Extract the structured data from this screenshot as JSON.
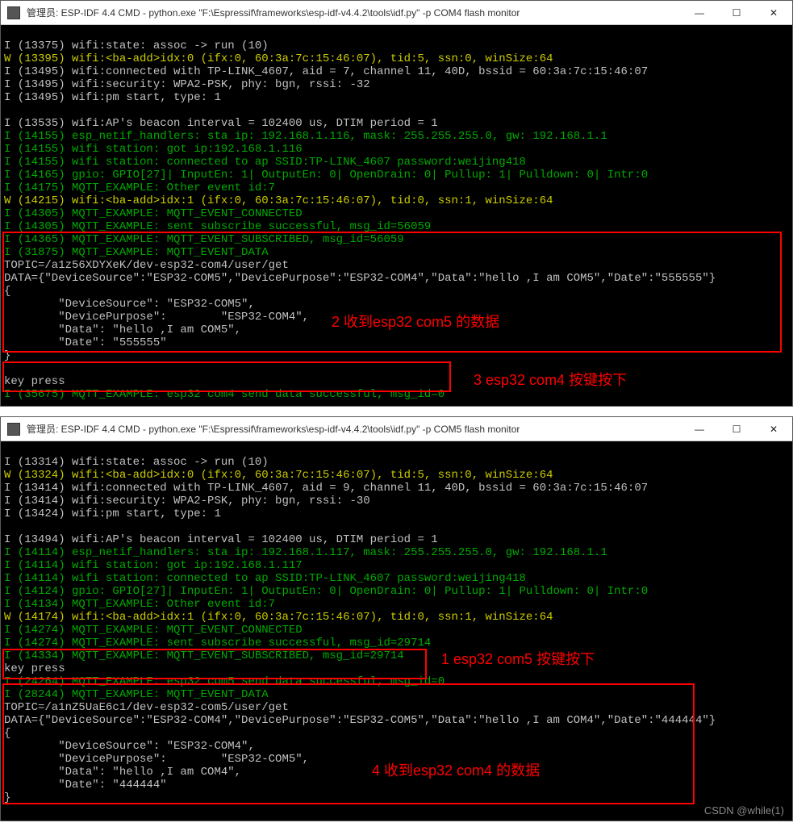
{
  "top": {
    "title": "管理员: ESP-IDF 4.4 CMD - python.exe  \"F:\\Espressif\\frameworks\\esp-idf-v4.4.2\\tools\\idf.py\" -p COM4 flash monitor",
    "lines": {
      "l01": "I (13375) wifi:state: assoc -> run (10)",
      "l02": "W (13395) wifi:<ba-add>idx:0 (ifx:0, 60:3a:7c:15:46:07), tid:5, ssn:0, winSize:64",
      "l03": "I (13495) wifi:connected with TP-LINK_4607, aid = 7, channel 11, 40D, bssid = 60:3a:7c:15:46:07",
      "l04": "I (13495) wifi:security: WPA2-PSK, phy: bgn, rssi: -32",
      "l05": "I (13495) wifi:pm start, type: 1",
      "l06": "",
      "l07": "I (13535) wifi:AP's beacon interval = 102400 us, DTIM period = 1",
      "l08": "I (14155) esp_netif_handlers: sta ip: 192.168.1.116, mask: 255.255.255.0, gw: 192.168.1.1",
      "l09": "I (14155) wifi station: got ip:192.168.1.116",
      "l10": "I (14155) wifi station: connected to ap SSID:TP-LINK_4607 password:weijing418",
      "l11": "I (14165) gpio: GPIO[27]| InputEn: 1| OutputEn: 0| OpenDrain: 0| Pullup: 1| Pulldown: 0| Intr:0",
      "l12": "I (14175) MQTT_EXAMPLE: Other event id:7",
      "l13": "W (14215) wifi:<ba-add>idx:1 (ifx:0, 60:3a:7c:15:46:07), tid:0, ssn:1, winSize:64",
      "l14": "I (14305) MQTT_EXAMPLE: MQTT_EVENT_CONNECTED",
      "l15": "I (14305) MQTT_EXAMPLE: sent subscribe successful, msg_id=56059",
      "l16": "I (14365) MQTT_EXAMPLE: MQTT_EVENT_SUBSCRIBED, msg_id=56059",
      "l17": "I (31875) MQTT_EXAMPLE: MQTT_EVENT_DATA",
      "l18": "TOPIC=/a1z56XDYXeK/dev-esp32-com4/user/get",
      "l19": "DATA={\"DeviceSource\":\"ESP32-COM5\",\"DevicePurpose\":\"ESP32-COM4\",\"Data\":\"hello ,I am COM5\",\"Date\":\"555555\"}",
      "l20": "{",
      "l21": "        \"DeviceSource\": \"ESP32-COM5\",",
      "l22": "        \"DevicePurpose\":        \"ESP32-COM4\",",
      "l23": "        \"Data\": \"hello ,I am COM5\",",
      "l24": "        \"Date\": \"555555\"",
      "l25": "}",
      "l26": "",
      "l27": "key press",
      "l28": "I (35675) MQTT_EXAMPLE: esp32 com4 send data successful, msg_id=0"
    },
    "annos": {
      "a2": "2 收到esp32 com5 的数据",
      "a3": "3 esp32 com4 按键按下"
    }
  },
  "bottom": {
    "title": "管理员: ESP-IDF 4.4 CMD - python.exe  \"F:\\Espressif\\frameworks\\esp-idf-v4.4.2\\tools\\idf.py\" -p COM5 flash monitor",
    "lines": {
      "l01": "I (13314) wifi:state: assoc -> run (10)",
      "l02": "W (13324) wifi:<ba-add>idx:0 (ifx:0, 60:3a:7c:15:46:07), tid:5, ssn:0, winSize:64",
      "l03": "I (13414) wifi:connected with TP-LINK_4607, aid = 9, channel 11, 40D, bssid = 60:3a:7c:15:46:07",
      "l04": "I (13414) wifi:security: WPA2-PSK, phy: bgn, rssi: -30",
      "l05": "I (13424) wifi:pm start, type: 1",
      "l06": "",
      "l07": "I (13494) wifi:AP's beacon interval = 102400 us, DTIM period = 1",
      "l08": "I (14114) esp_netif_handlers: sta ip: 192.168.1.117, mask: 255.255.255.0, gw: 192.168.1.1",
      "l09": "I (14114) wifi station: got ip:192.168.1.117",
      "l10": "I (14114) wifi station: connected to ap SSID:TP-LINK_4607 password:weijing418",
      "l11": "I (14124) gpio: GPIO[27]| InputEn: 1| OutputEn: 0| OpenDrain: 0| Pullup: 1| Pulldown: 0| Intr:0",
      "l12": "I (14134) MQTT_EXAMPLE: Other event id:7",
      "l13": "W (14174) wifi:<ba-add>idx:1 (ifx:0, 60:3a:7c:15:46:07), tid:0, ssn:1, winSize:64",
      "l14": "I (14274) MQTT_EXAMPLE: MQTT_EVENT_CONNECTED",
      "l15": "I (14274) MQTT_EXAMPLE: sent subscribe successful, msg_id=29714",
      "l16": "I (14334) MQTT_EXAMPLE: MQTT_EVENT_SUBSCRIBED, msg_id=29714",
      "l17": "key press",
      "l18": "I (24264) MQTT_EXAMPLE: esp32 com5 send data successful, msg_id=0",
      "l19": "I (28244) MQTT_EXAMPLE: MQTT_EVENT_DATA",
      "l20": "TOPIC=/a1nZ5UaE6c1/dev-esp32-com5/user/get",
      "l21": "DATA={\"DeviceSource\":\"ESP32-COM4\",\"DevicePurpose\":\"ESP32-COM5\",\"Data\":\"hello ,I am COM4\",\"Date\":\"444444\"}",
      "l22": "{",
      "l23": "        \"DeviceSource\": \"ESP32-COM4\",",
      "l24": "        \"DevicePurpose\":        \"ESP32-COM5\",",
      "l25": "        \"Data\": \"hello ,I am COM4\",",
      "l26": "        \"Date\": \"444444\"",
      "l27": "}"
    },
    "annos": {
      "a1": "1 esp32 com5 按键按下",
      "a4": "4 收到esp32 com4 的数据"
    }
  },
  "watermark": "CSDN @while(1)",
  "glyphs": {
    "min": "—",
    "max": "☐",
    "close": "✕"
  }
}
